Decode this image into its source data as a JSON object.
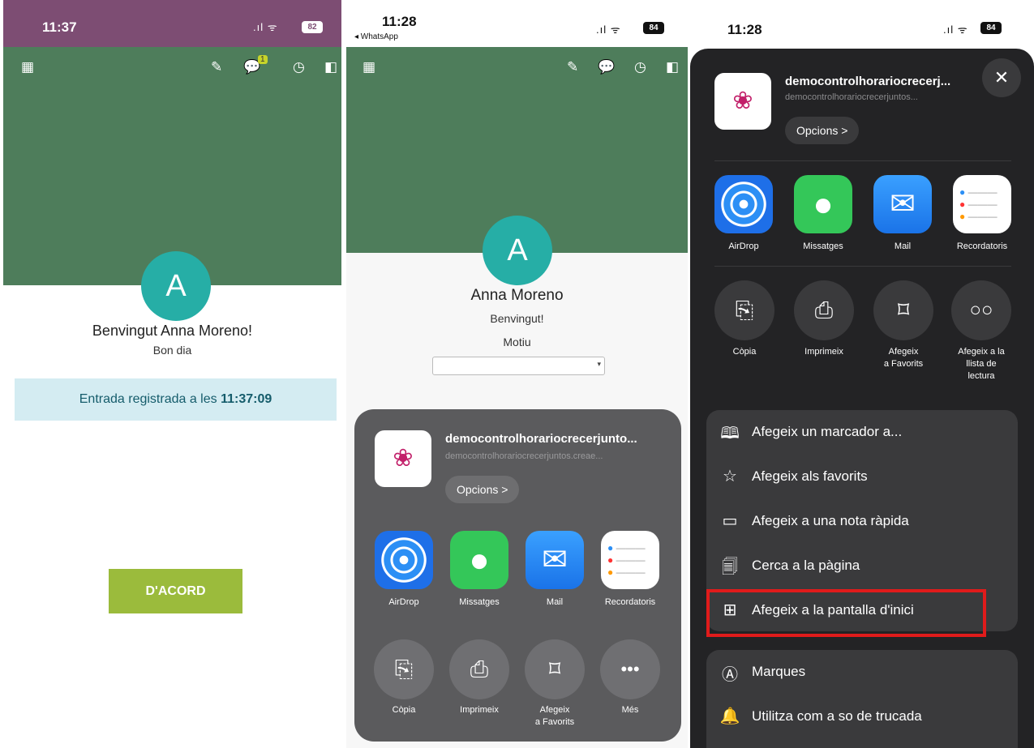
{
  "panel1": {
    "time": "11:37",
    "battery": "82",
    "greeting": "Benvingut Anna Moreno!",
    "subgreeting": "Bon dia",
    "avatar_letter": "A",
    "entry_text": "Entrada registrada a les ",
    "entry_time": "11:37:09",
    "ok_button": "D'ACORD",
    "badge": "1"
  },
  "panel2": {
    "time": "11:28",
    "back_app": "◂ WhatsApp",
    "battery": "84",
    "avatar_letter": "A",
    "name": "Anna Moreno",
    "welcome": "Benvingut!",
    "reason_label": "Motiu",
    "reason_value": "",
    "share": {
      "title": "democontrolhorariocrecerjunto...",
      "url": "democontrolhorariocrecerjuntos.creae...",
      "options_button": "Opcions >",
      "apps": [
        "AirDrop",
        "Missatges",
        "Mail",
        "Recordatoris"
      ],
      "actions": [
        "Còpia",
        "Imprimeix",
        "Afegeix\na Favorits",
        "Més"
      ]
    }
  },
  "panel3": {
    "time": "11:28",
    "battery": "84",
    "close_icon": "✕",
    "share": {
      "title": "democontrolhorariocrecerj...",
      "url": "democontrolhorariocrecerjuntos...",
      "options_button": "Opcions >",
      "apps": [
        "AirDrop",
        "Missatges",
        "Mail",
        "Recordatoris"
      ],
      "actions": [
        "Còpia",
        "Imprimeix",
        "Afegeix\na Favorits",
        "Afegeix a la\nllista de\nlectura"
      ],
      "menu": [
        {
          "icon": "book-icon",
          "label": "Afegeix un marcador a..."
        },
        {
          "icon": "star-icon",
          "label": "Afegeix als favorits"
        },
        {
          "icon": "quick-note-icon",
          "label": "Afegeix a una nota ràpida"
        },
        {
          "icon": "find-page-icon",
          "label": "Cerca a la pàgina"
        },
        {
          "icon": "plus-square-icon",
          "label": "Afegeix a la pantalla d'inici"
        }
      ],
      "menu2": [
        {
          "icon": "markup-icon",
          "label": "Marques"
        },
        {
          "icon": "bell-icon",
          "label": "Utilitza com a so de trucada"
        }
      ]
    }
  },
  "colors": {
    "toolbar_green": "#4e7d5b",
    "avatar_teal": "#26aea6",
    "ok_button_green": "#9bbb3c",
    "entry_bg": "#d4ecf2",
    "highlight_red": "#e01b1b"
  }
}
